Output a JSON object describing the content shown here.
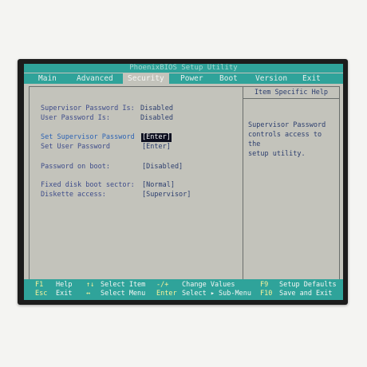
{
  "bios": {
    "title": "PhoenixBIOS Setup Utility",
    "menu": [
      {
        "label": "Main",
        "active": false
      },
      {
        "label": "Advanced",
        "active": false
      },
      {
        "label": "Security",
        "active": true
      },
      {
        "label": "Power",
        "active": false
      },
      {
        "label": "Boot",
        "active": false
      },
      {
        "label": "Version",
        "active": false
      },
      {
        "label": "Exit",
        "active": false
      }
    ],
    "status": [
      {
        "label": "Supervisor Password Is:",
        "value": "Disabled"
      },
      {
        "label": "User Password Is:",
        "value": "Disabled"
      }
    ],
    "settings": [
      {
        "label": "Set Supervisor Password",
        "value": "[Enter]",
        "selected": true
      },
      {
        "label": "Set User Password",
        "value": "[Enter]",
        "selected": false
      },
      {
        "label": "Password on boot:",
        "value": "[Disabled]",
        "selected": false
      },
      {
        "label": "Fixed disk boot sector:",
        "value": "[Normal]",
        "selected": false
      },
      {
        "label": "Diskette access:",
        "value": "[Supervisor]",
        "selected": false
      }
    ],
    "help": {
      "heading": "Item Specific Help",
      "text": "Supervisor Password\ncontrols access to the\nsetup utility."
    },
    "footer": {
      "f1_key": "F1",
      "f1_desc": "Help",
      "updown_key": "↑↓",
      "updown_desc": "Select Item",
      "plusminus_key": "-/+",
      "plusminus_desc": "Change Values",
      "f9_key": "F9",
      "f9_desc": "Setup Defaults",
      "esc_key": "Esc",
      "esc_desc": "Exit",
      "leftright_key": "↔",
      "leftright_desc": "Select Menu",
      "enter_key": "Enter",
      "enter_desc": "Select ▸ Sub-Menu",
      "f10_key": "F10",
      "f10_desc": "Save and Exit"
    }
  },
  "colors": {
    "accent": "#2fa39a",
    "screen_bg": "#c3c3bb",
    "footer_key": "#f6f29a",
    "highlight_bg": "#0e1020"
  }
}
